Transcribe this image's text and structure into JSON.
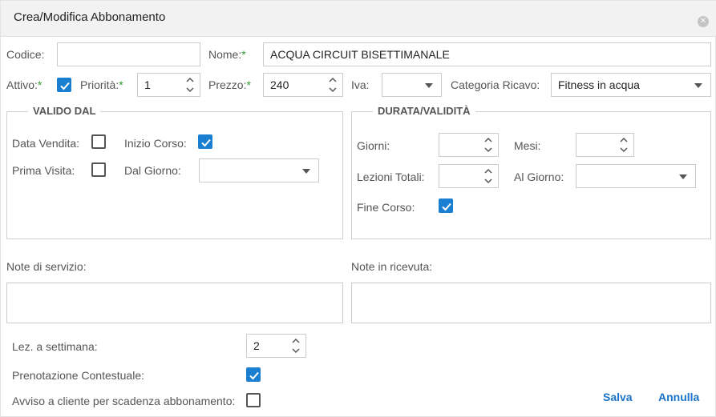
{
  "dialog": {
    "title": "Crea/Modifica Abbonamento",
    "close_glyph": "✕"
  },
  "form": {
    "codice": {
      "label": "Codice:",
      "value": ""
    },
    "nome": {
      "label": "Nome:",
      "required_mark": "*",
      "value": "ACQUA CIRCUIT BISETTIMANALE"
    },
    "attivo": {
      "label": "Attivo:",
      "required_mark": "*",
      "checked": true
    },
    "priorita": {
      "label": "Priorità:",
      "required_mark": "*",
      "value": "1"
    },
    "prezzo": {
      "label": "Prezzo:",
      "required_mark": "*",
      "value": "240"
    },
    "iva": {
      "label": "Iva:",
      "value": ""
    },
    "categoria_ricavo": {
      "label": "Categoria Ricavo:",
      "value": "Fitness in acqua"
    }
  },
  "valido_dal": {
    "legend": "VALIDO DAL",
    "data_vendita": {
      "label": "Data Vendita:",
      "checked": false
    },
    "inizio_corso": {
      "label": "Inizio Corso:",
      "checked": true
    },
    "prima_visita": {
      "label": "Prima Visita:",
      "checked": false
    },
    "dal_giorno": {
      "label": "Dal Giorno:",
      "value": ""
    }
  },
  "durata": {
    "legend": "DURATA/VALIDITÀ",
    "giorni": {
      "label": "Giorni:",
      "value": ""
    },
    "mesi": {
      "label": "Mesi:",
      "value": ""
    },
    "lezioni_totali": {
      "label": "Lezioni Totali:",
      "value": ""
    },
    "al_giorno": {
      "label": "Al Giorno:",
      "value": ""
    },
    "fine_corso": {
      "label": "Fine Corso:",
      "checked": true
    }
  },
  "note": {
    "servizio_label": "Note di servizio:",
    "ricevuta_label": "Note in ricevuta:"
  },
  "extra": {
    "lez_settimana": {
      "label": "Lez. a settimana:",
      "value": "2"
    },
    "prenotazione": {
      "label": "Prenotazione Contestuale:",
      "checked": true
    },
    "avviso": {
      "label": "Avviso a cliente per scadenza abbonamento:",
      "checked": false
    }
  },
  "actions": {
    "save": "Salva",
    "cancel": "Annulla"
  },
  "colors": {
    "accent": "#1a7fd1",
    "required": "#2e9a2e",
    "link": "#1a73c8"
  }
}
